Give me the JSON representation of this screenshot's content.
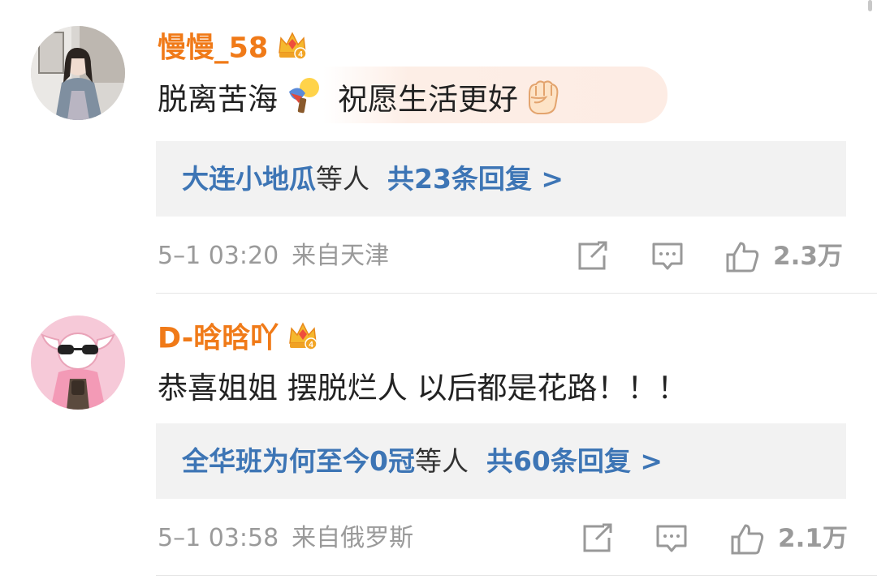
{
  "comments": [
    {
      "username": "慢慢_58",
      "text_part1": "脱离苦海",
      "text_part2": "祝愿生活更好",
      "replies_names": "大连小地瓜",
      "replies_others": "等人",
      "replies_count": "共23条回复 >",
      "time": "5–1 03:20",
      "location": "来自天津",
      "likes": "2.3万",
      "crown_level": "4"
    },
    {
      "username": "D-晗晗吖",
      "text": "恭喜姐姐 摆脱烂人 以后都是花路！！！",
      "replies_names": "全华班为何至今0冠",
      "replies_others": "等人",
      "replies_count": "共60条回复 >",
      "time": "5–1 03:58",
      "location": "来自俄罗斯",
      "likes": "2.1万",
      "crown_level": "4"
    }
  ],
  "colors": {
    "username": "#f07a18",
    "reply_link": "#3d75b5",
    "meta": "#9a9a9a",
    "reply_bg": "#f2f2f2"
  },
  "icons": [
    "crown-badge-icon",
    "bulb-emoji-icon",
    "raised-fist-emoji-icon",
    "repost-icon",
    "comment-icon",
    "like-icon"
  ]
}
